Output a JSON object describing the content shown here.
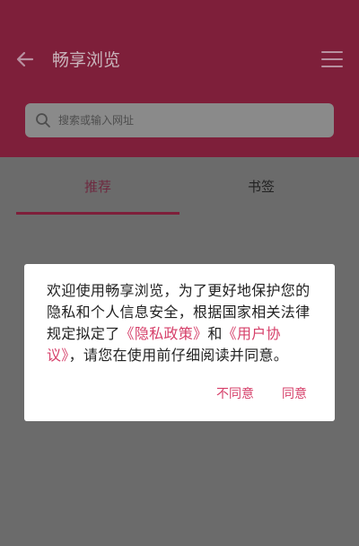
{
  "header": {
    "title": "畅享浏览",
    "back_icon": "back-arrow-icon",
    "menu_icon": "hamburger-menu-icon",
    "color": "#7e1f3a"
  },
  "search": {
    "placeholder": "搜索或输入网址",
    "icon": "search-icon"
  },
  "tabs": [
    {
      "label": "推荐",
      "active": true
    },
    {
      "label": "书签",
      "active": false
    }
  ],
  "dialog": {
    "text_1": "欢迎使用畅享浏览，为了更好地保护您的隐私和个人信息安全，根据国家相关法律规定拟定了",
    "privacy_link": "《隐私政策》",
    "text_2": "和",
    "agreement_link": "《用户协议》",
    "text_3": "，请您在使用前仔细阅读并同意。",
    "disagree_label": "不同意",
    "agree_label": "同意",
    "accent_color": "#d6406a"
  }
}
